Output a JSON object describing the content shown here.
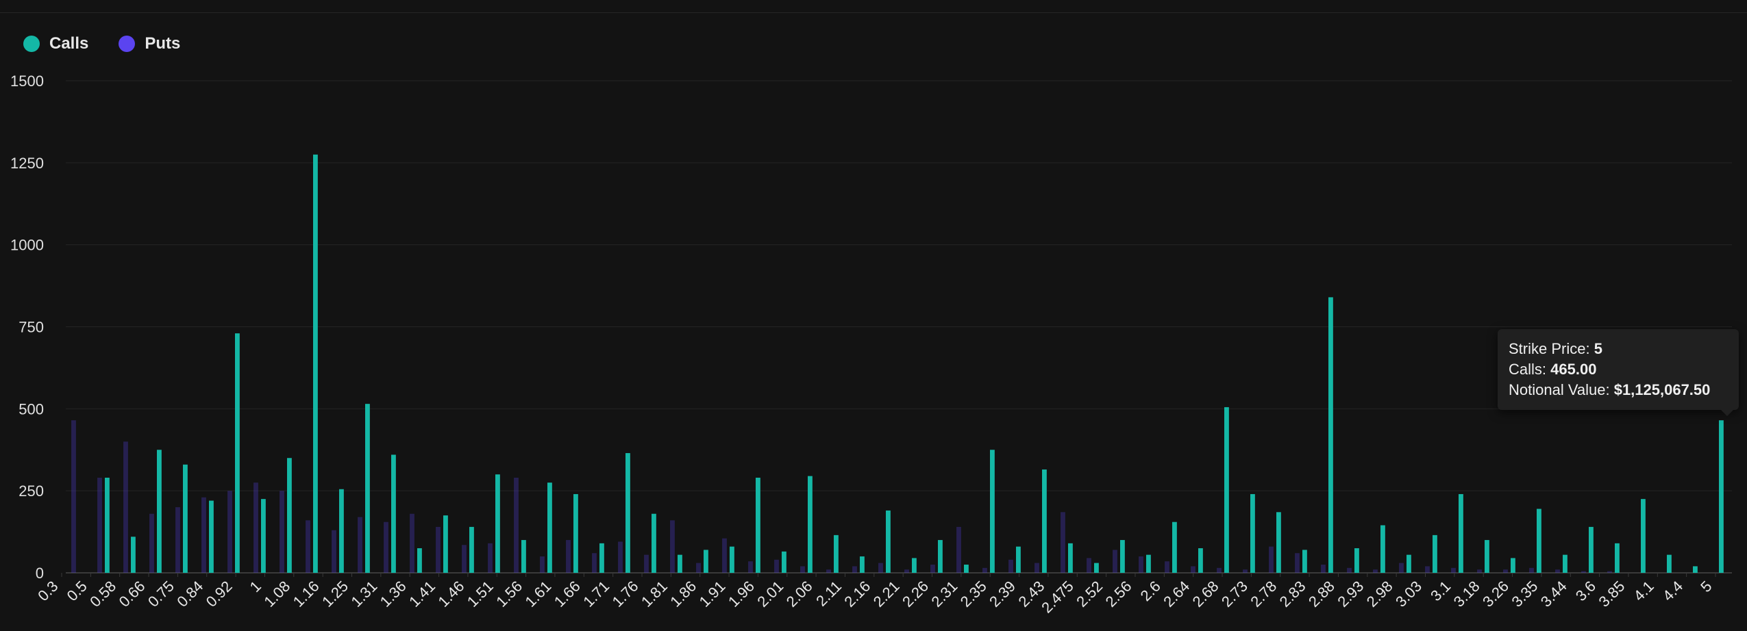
{
  "legend": {
    "calls_label": "Calls",
    "puts_label": "Puts",
    "calls_color": "#14b8a6",
    "puts_color": "#5b44f0"
  },
  "tooltip": {
    "strike_label": "Strike Price:",
    "strike_value": "5",
    "calls_label": "Calls:",
    "calls_value": "465.00",
    "notional_label": "Notional Value:",
    "notional_value": "$1,125,067.50"
  },
  "chart_data": {
    "type": "bar",
    "ylim": [
      0,
      1500
    ],
    "yticks": [
      0,
      250,
      500,
      750,
      1000,
      1250,
      1500
    ],
    "grid": true,
    "legend": "top-left",
    "categories": [
      "0.3",
      "0.5",
      "0.58",
      "0.66",
      "0.75",
      "0.84",
      "0.92",
      "1",
      "1.08",
      "1.16",
      "1.25",
      "1.31",
      "1.36",
      "1.41",
      "1.46",
      "1.51",
      "1.56",
      "1.61",
      "1.66",
      "1.71",
      "1.76",
      "1.81",
      "1.86",
      "1.91",
      "1.96",
      "2.01",
      "2.06",
      "2.11",
      "2.16",
      "2.21",
      "2.26",
      "2.31",
      "2.35",
      "2.39",
      "2.43",
      "2.475",
      "2.52",
      "2.56",
      "2.6",
      "2.64",
      "2.68",
      "2.73",
      "2.78",
      "2.83",
      "2.88",
      "2.93",
      "2.98",
      "3.03",
      "3.1",
      "3.18",
      "3.26",
      "3.35",
      "3.44",
      "3.6",
      "3.85",
      "4.1",
      "4.4",
      "5"
    ],
    "series": [
      {
        "name": "Calls",
        "values": [
          0,
          290,
          110,
          375,
          330,
          220,
          730,
          225,
          350,
          1275,
          255,
          515,
          360,
          75,
          175,
          140,
          300,
          100,
          275,
          240,
          90,
          365,
          180,
          55,
          70,
          80,
          290,
          65,
          295,
          115,
          50,
          190,
          45,
          100,
          25,
          375,
          80,
          315,
          90,
          30,
          100,
          55,
          155,
          75,
          505,
          240,
          185,
          70,
          840,
          75,
          145,
          55,
          115,
          240,
          100,
          45,
          195,
          55,
          140,
          90,
          225,
          55,
          20,
          465
        ]
      },
      {
        "name": "Puts",
        "values": [
          465,
          290,
          400,
          180,
          200,
          230,
          250,
          275,
          250,
          160,
          130,
          170,
          155,
          180,
          140,
          85,
          90,
          290,
          50,
          100,
          60,
          95,
          55,
          160,
          30,
          105,
          35,
          40,
          20,
          10,
          20,
          30,
          10,
          25,
          140,
          15,
          40,
          30,
          185,
          45,
          70,
          50,
          35,
          20,
          15,
          10,
          80,
          60,
          25,
          15,
          10,
          30,
          20,
          15,
          10,
          10,
          15,
          10,
          5,
          5,
          0,
          0,
          0,
          0
        ]
      }
    ]
  }
}
